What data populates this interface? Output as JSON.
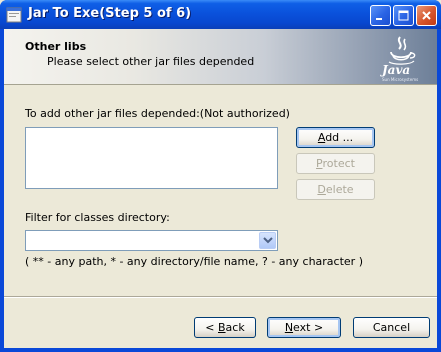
{
  "window": {
    "title": "Jar To Exe(Step 5 of 6)",
    "accent": "#0a48d8"
  },
  "header": {
    "title": "Other libs",
    "subtitle": "Please select other jar files depended",
    "logo_text": "Java",
    "logo_tm": "Sun Microsystems"
  },
  "jars": {
    "label": "To add other jar files depended:(Not authorized)",
    "items": []
  },
  "buttons": {
    "add": {
      "pre": "",
      "key": "A",
      "post": "dd ..."
    },
    "protect": {
      "pre": "",
      "key": "P",
      "post": "rotect"
    },
    "delete": {
      "pre": "",
      "key": "D",
      "post": "elete"
    },
    "back": {
      "pre": "< ",
      "key": "B",
      "post": "ack"
    },
    "next": {
      "pre": "",
      "key": "N",
      "post": "ext >"
    },
    "cancel": {
      "pre": "",
      "key": "",
      "post": "Cancel"
    }
  },
  "filter": {
    "label": "Filter for classes directory:",
    "value": "",
    "hint": "( ** - any path, * - any directory/file name, ? - any character )"
  }
}
